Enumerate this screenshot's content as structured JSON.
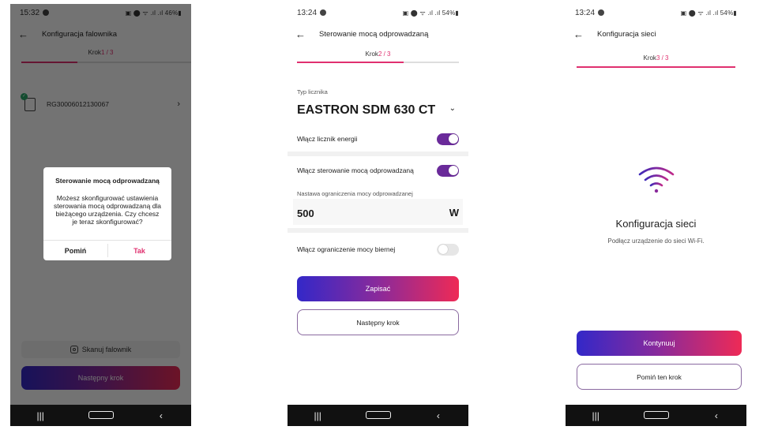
{
  "screens": [
    {
      "status": {
        "time": "15:32",
        "right": "▣ ⬤ ᯤ .ıl .ıl 46%▮"
      },
      "header": {
        "title": "Konfiguracja falownika"
      },
      "step": {
        "label": "Krok",
        "current": "1 / 3",
        "progress": 0.33
      },
      "device": {
        "serial": "RG30006012130067"
      },
      "scan_button": {
        "label": "Skanuj falownik"
      },
      "next_button": {
        "label": "Następny krok"
      },
      "dialog": {
        "title": "Sterowanie mocą odprowadzaną",
        "body": "Możesz skonfigurować ustawienia sterowania mocą odprowadzaną dla bieżącego urządzenia. Czy chcesz je teraz skonfigurować?",
        "skip": "Pomiń",
        "confirm": "Tak"
      }
    },
    {
      "status": {
        "time": "13:24",
        "right": "▣ ⬤ ᯤ .ıl .ıl 54%▮"
      },
      "header": {
        "title": "Sterowanie mocą odprowadzaną"
      },
      "step": {
        "label": "Krok",
        "current": "2 / 3",
        "progress": 0.66
      },
      "meter": {
        "label": "Typ licznika",
        "value": "EASTRON SDM 630 CT"
      },
      "toggle_meter": {
        "label": "Włącz licznik energii",
        "on": true
      },
      "toggle_export": {
        "label": "Włącz sterowanie mocą odprowadzaną",
        "on": true
      },
      "limit": {
        "label": "Nastawa ograniczenia mocy odprowadzanej",
        "value": "500",
        "unit": "W"
      },
      "toggle_reactive": {
        "label": "Włącz ograniczenie mocy biernej",
        "on": false
      },
      "save_button": {
        "label": "Zapisać"
      },
      "next_button": {
        "label": "Następny krok"
      }
    },
    {
      "status": {
        "time": "13:24",
        "right": "▣ ⬤ ᯤ .ıl .ıl 54%▮"
      },
      "header": {
        "title": "Konfiguracja sieci"
      },
      "step": {
        "label": "Krok",
        "current": "3 / 3",
        "progress": 1.0
      },
      "network": {
        "title": "Konfiguracja sieci",
        "subtitle": "Podłącz urządzenie do sieci Wi-Fi."
      },
      "continue_button": {
        "label": "Kontynuuj"
      },
      "skip_button": {
        "label": "Pomiń ten krok"
      }
    }
  ],
  "colors": {
    "accent": "#e0306f",
    "toggle_on": "#6a2a9a",
    "gradient_start": "#3328c8",
    "gradient_end": "#ee2a56"
  },
  "navbar": {
    "recents": "|||",
    "back": "‹"
  }
}
